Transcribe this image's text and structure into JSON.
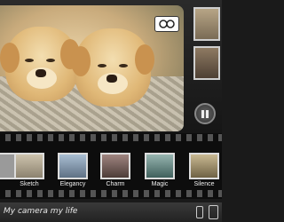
{
  "filters": [
    {
      "label": "",
      "color": "#9a9a9a"
    },
    {
      "label": "Sketch",
      "color": "#b0a89a"
    },
    {
      "label": "Elegancy",
      "color": "#8aa0b8"
    },
    {
      "label": "Charm",
      "color": "#7d6a66"
    },
    {
      "label": "Magic",
      "color": "#6c8c8a"
    },
    {
      "label": "Silence",
      "color": "#a99a76"
    }
  ],
  "footer": {
    "tagline": "My camera my life"
  },
  "colors": {
    "film_bg": "#0d0d0d",
    "bar_bg": "#2a2a2a"
  }
}
